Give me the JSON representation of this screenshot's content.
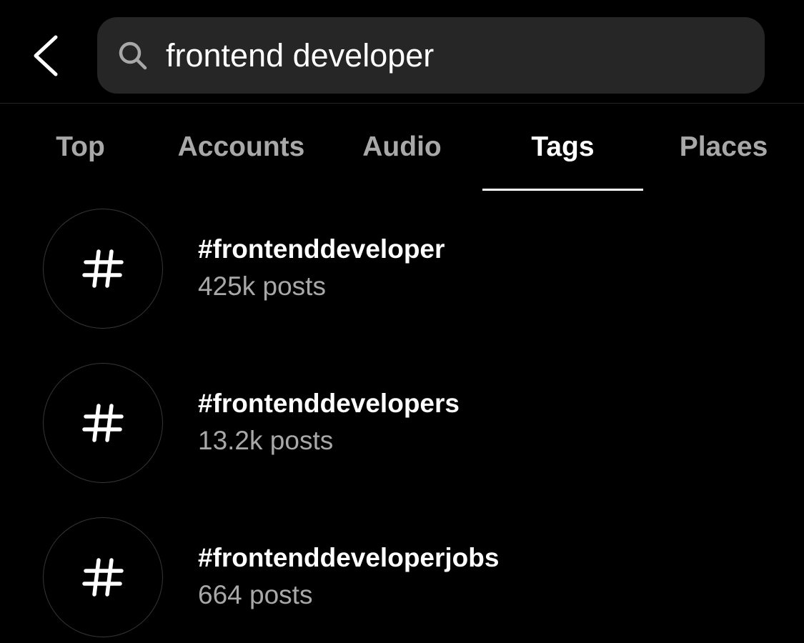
{
  "header": {
    "back_icon": "chevron-left-icon",
    "search_icon": "search-icon",
    "search_value": "frontend developer"
  },
  "tabs": [
    {
      "label": "Top"
    },
    {
      "label": "Accounts"
    },
    {
      "label": "Audio"
    },
    {
      "label": "Tags",
      "active": true
    },
    {
      "label": "Places"
    }
  ],
  "results": [
    {
      "icon": "hashtag-icon",
      "name": "#frontenddeveloper",
      "count": "425k posts"
    },
    {
      "icon": "hashtag-icon",
      "name": "#frontenddevelopers",
      "count": "13.2k posts"
    },
    {
      "icon": "hashtag-icon",
      "name": "#frontenddeveloperjobs",
      "count": "664 posts"
    }
  ]
}
